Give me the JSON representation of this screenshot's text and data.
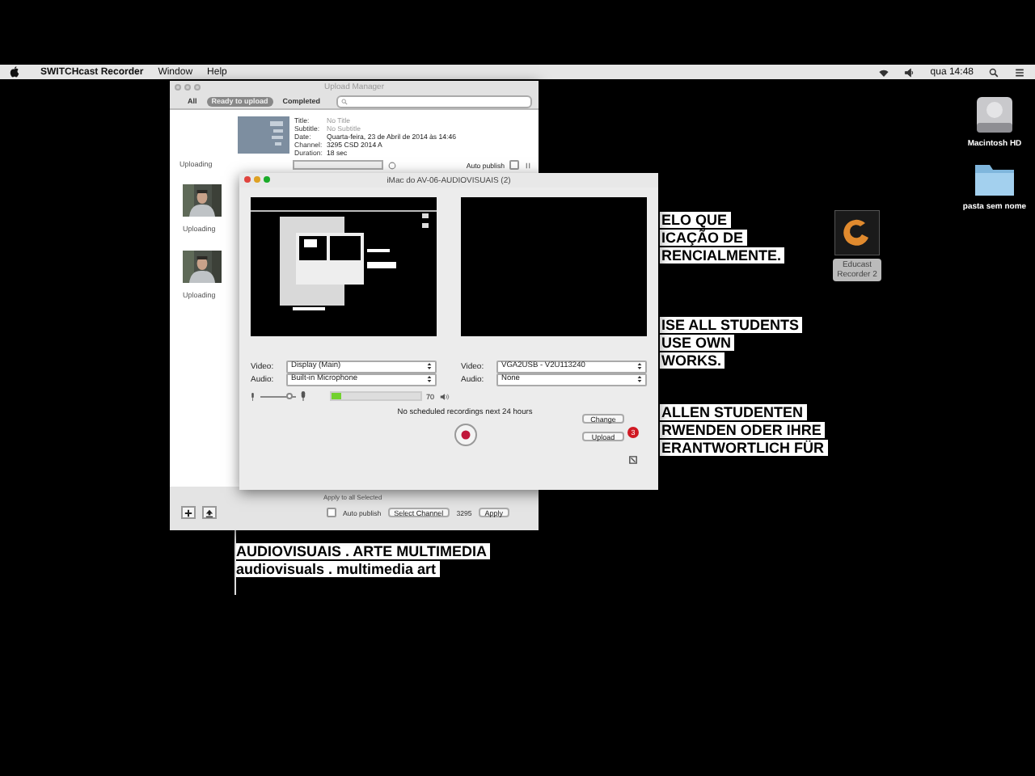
{
  "menu_bar": {
    "app_name": "SWITCHcast Recorder",
    "menus": [
      "Window",
      "Help"
    ],
    "clock": "qua 14:48"
  },
  "desktop": {
    "icons": [
      {
        "kind": "drive",
        "label": "Macintosh HD"
      },
      {
        "kind": "folder",
        "label": "pasta sem nome"
      },
      {
        "kind": "app",
        "label": "Educast Recorder 2"
      }
    ],
    "text_blocks": [
      {
        "lines": [
          "ELO QUE",
          "ICAÇÃO DE",
          "RENCIALMENTE."
        ]
      },
      {
        "lines": [
          "ISE ALL STUDENTS",
          "USE OWN",
          "WORKS."
        ]
      },
      {
        "lines": [
          "ALLEN STUDENTEN",
          "RWENDEN ODER IHRE",
          "ERANTWORTLICH FÜR"
        ]
      }
    ],
    "caption": [
      "AUDIOVISUAIS . ARTE MULTIMEDIA",
      "audiovisuals . multimedia art"
    ]
  },
  "upload_manager": {
    "title": "Upload Manager",
    "tabs": [
      {
        "label": "All",
        "selected": false
      },
      {
        "label": "Ready to upload",
        "selected": true
      },
      {
        "label": "Completed",
        "selected": false
      }
    ],
    "items": [
      {
        "kind": "detailed",
        "status": "Uploading",
        "fields": [
          {
            "label": "Title:",
            "value": "No Title",
            "empty": true
          },
          {
            "label": "Subtitle:",
            "value": "No Subtitle",
            "empty": true
          },
          {
            "label": "Date:",
            "value": "Quarta-feira, 23 de Abril de 2014 às 14:46",
            "empty": false
          },
          {
            "label": "Channel:",
            "value": "3295  CSD 2014 A",
            "empty": false
          },
          {
            "label": "Duration:",
            "value": "18 sec",
            "empty": false
          }
        ],
        "level": 0,
        "auto_publish_label": "Auto publish",
        "auto_publish": false
      },
      {
        "kind": "compact",
        "status": "Uploading"
      },
      {
        "kind": "compact",
        "status": "Uploading"
      }
    ],
    "footer": {
      "heading": "Apply to all Selected",
      "auto_publish_label": "Auto publish",
      "auto_publish": false,
      "channel_button": "Select Channel",
      "channel": "3295",
      "apply_button": "Apply"
    }
  },
  "recorder": {
    "title": "iMac do AV-06-AUDIOVISUAIS (2)",
    "sources": [
      {
        "video_label": "Video:",
        "video": "Display (Main)",
        "audio_label": "Audio:",
        "audio": "Built-in Microphone"
      },
      {
        "video_label": "Video:",
        "video": "VGA2USB - V2U113240",
        "audio_label": "Audio:",
        "audio": "None"
      }
    ],
    "volume": {
      "level": 0.85
    },
    "meter": {
      "level": 0.12,
      "reading": "70"
    },
    "status": "No scheduled recordings next 24 hours",
    "change_button": "Change",
    "upload_button": "Upload",
    "upload_badge": "3"
  }
}
